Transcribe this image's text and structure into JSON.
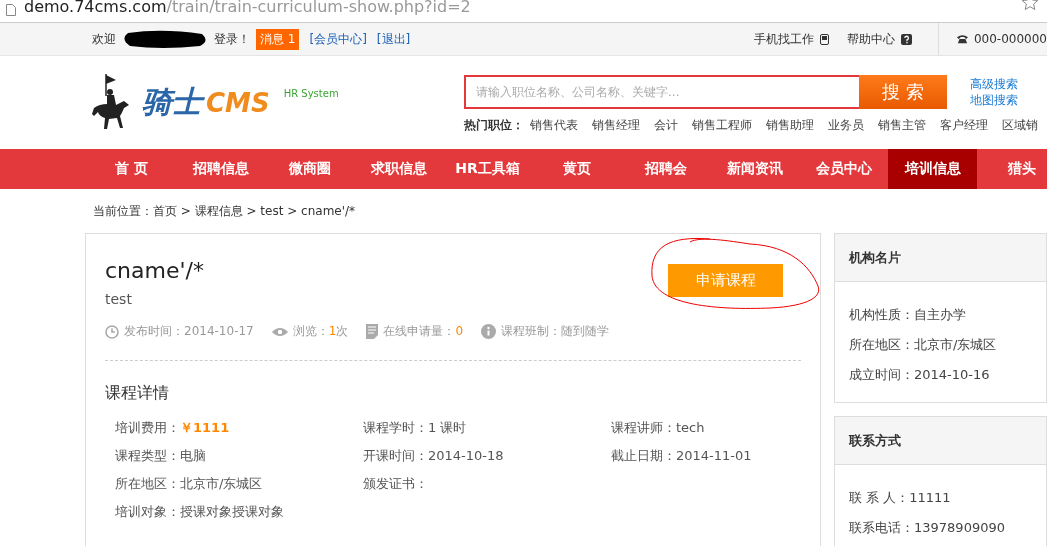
{
  "address_bar": {
    "host": "demo.74cms.com",
    "path": "/train/train-curriculum-show.php?id=2"
  },
  "top_bar": {
    "welcome": "欢迎",
    "login": "登录！",
    "messages": "消息 1",
    "links": [
      "[会员中心]",
      "[退出]"
    ],
    "right": [
      {
        "label": "手机找工作",
        "kind": "phone"
      },
      {
        "label": "帮助中心",
        "kind": "help"
      }
    ],
    "hotline": "000-000000"
  },
  "logo": {
    "name": "骑士",
    "brand": "CMS",
    "tagline": "HR System"
  },
  "search": {
    "placeholder": "请输入职位名称、公司名称、关键字...",
    "button": "搜 索",
    "links": [
      "高级搜索",
      "地图搜索"
    ],
    "hot_label": "热门职位：",
    "hot": [
      "销售代表",
      "销售经理",
      "会计",
      "销售工程师",
      "销售助理",
      "业务员",
      "销售主管",
      "客户经理",
      "区域销"
    ]
  },
  "nav": [
    {
      "label": "首 页",
      "selected": false
    },
    {
      "label": "招聘信息",
      "selected": false
    },
    {
      "label": "微商圈",
      "selected": false
    },
    {
      "label": "求职信息",
      "selected": false
    },
    {
      "label": "HR工具箱",
      "selected": false
    },
    {
      "label": "黄页",
      "selected": false
    },
    {
      "label": "招聘会",
      "selected": false
    },
    {
      "label": "新闻资讯",
      "selected": false
    },
    {
      "label": "会员中心",
      "selected": false
    },
    {
      "label": "培训信息",
      "selected": true
    },
    {
      "label": "猎头",
      "selected": false
    }
  ],
  "breadcrumb": "当前位置：首页 > 课程信息 > test > cname'/*",
  "course": {
    "title": "cname'/*",
    "subtitle": "test",
    "apply_button": "申请课程",
    "meta": [
      {
        "kind": "clock",
        "label": "发布时间：",
        "value": "2014-10-17",
        "highlight": false
      },
      {
        "kind": "views",
        "label": "浏览：",
        "value": "1",
        "suffix": "次",
        "highlight": true
      },
      {
        "kind": "applications",
        "label": "在线申请量：",
        "value": "0",
        "highlight": true
      },
      {
        "kind": "info",
        "label": "课程班制：",
        "value": "随到随学",
        "highlight": false
      }
    ],
    "details_title": "课程详情",
    "detail_rows": [
      [
        {
          "label": "培训费用：",
          "value": "￥1111",
          "highlight": true
        },
        {
          "label": "课程学时：",
          "value": "1 课时",
          "highlight": false
        },
        {
          "label": "课程讲师：",
          "value": "tech",
          "highlight": false
        }
      ],
      [
        {
          "label": "课程类型：",
          "value": "电脑",
          "highlight": false
        },
        {
          "label": "开课时间：",
          "value": "2014-10-18",
          "highlight": false
        },
        {
          "label": "截止日期：",
          "value": "2014-11-01",
          "highlight": false
        }
      ],
      [
        {
          "label": "所在地区：",
          "value": "北京市/东城区",
          "highlight": false
        },
        {
          "label": "颁发证书："
        }
      ],
      [
        {
          "label": "培训对象：",
          "value": "授课对象授课对象",
          "highlight": false
        }
      ]
    ]
  },
  "sidebar": [
    {
      "title": "机构名片",
      "items": [
        "机构性质：自主办学",
        "所在地区：北京市/东城区",
        "成立时间：2014-10-16"
      ]
    },
    {
      "title": "联系方式",
      "items": [
        "联 系 人：11111",
        "联系电话：13978909090"
      ]
    }
  ]
}
